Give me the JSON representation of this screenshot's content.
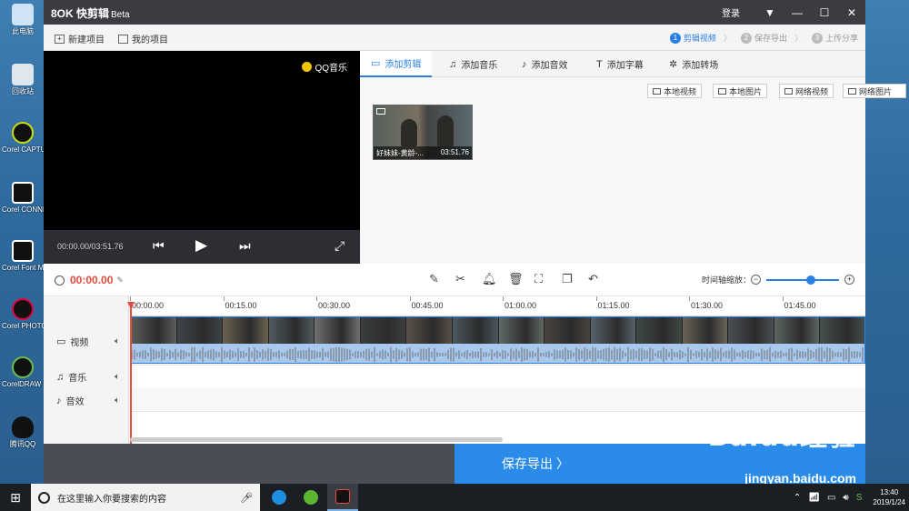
{
  "desktop": {
    "icons": [
      {
        "label": "此电脑",
        "color": "#cfe3f5"
      },
      {
        "label": "回收站",
        "color": "#dfe7ee"
      },
      {
        "label": "Corel CAPTU...",
        "color": "#111111"
      },
      {
        "label": "Corel CONNE...",
        "color": "#111111"
      },
      {
        "label": "Corel Font Manage...",
        "color": "#111111"
      },
      {
        "label": "Corel PHOTO-PA...",
        "color": "#111111"
      },
      {
        "label": "CorelDRAW 2018",
        "color": "#111111"
      },
      {
        "label": "腾讯QQ",
        "color": "#f2f2f2"
      }
    ]
  },
  "titlebar": {
    "logo": "8OK 快剪辑",
    "beta": "Beta",
    "login": "登录",
    "dropdown_icon": "▼",
    "minimize_icon": "—",
    "maximize_icon": "☐",
    "close_icon": "✕"
  },
  "toolbar": {
    "new_project": "新建项目",
    "my_projects": "我的项目",
    "steps": [
      {
        "num": "1",
        "label": "剪辑视频"
      },
      {
        "num": "2",
        "label": "保存导出"
      },
      {
        "num": "3",
        "label": "上传分享"
      }
    ]
  },
  "preview": {
    "watermark": "QQ音乐",
    "time": "00:00.00/03:51.76"
  },
  "tabs": [
    {
      "label": "添加剪辑",
      "icon": "▭"
    },
    {
      "label": "添加音乐",
      "icon": "♫"
    },
    {
      "label": "添加音效",
      "icon": "♪"
    },
    {
      "label": "添加字幕",
      "icon": "T"
    },
    {
      "label": "添加转场",
      "icon": "✲"
    }
  ],
  "source_buttons": [
    "本地视频",
    "本地图片",
    "网络视频",
    "网络图片"
  ],
  "clip": {
    "name": "好妹妹-黄龄-...",
    "duration": "03:51.76"
  },
  "edit": {
    "current_time": "00:00.00",
    "zoom_label": "时间轴缩放：",
    "zoom_level": 0.6
  },
  "timeline": {
    "ticks": [
      "00:00.00",
      "00:15.00",
      "00:30.00",
      "00:45.00",
      "01:00.00",
      "01:15.00",
      "01:30.00",
      "01:45.00"
    ],
    "tracks": [
      {
        "label": "视频",
        "icon": "▭"
      },
      {
        "label": "音乐",
        "icon": "♫"
      },
      {
        "label": "音效",
        "icon": "♪"
      }
    ]
  },
  "save_export": "保存导出  〉",
  "watermark": {
    "brand": "Baidu经验",
    "url": "jingyan.baidu.com"
  },
  "taskbar": {
    "search_placeholder": "在这里输入你要搜索的内容",
    "time": "13:40",
    "date": "2019/1/24"
  }
}
